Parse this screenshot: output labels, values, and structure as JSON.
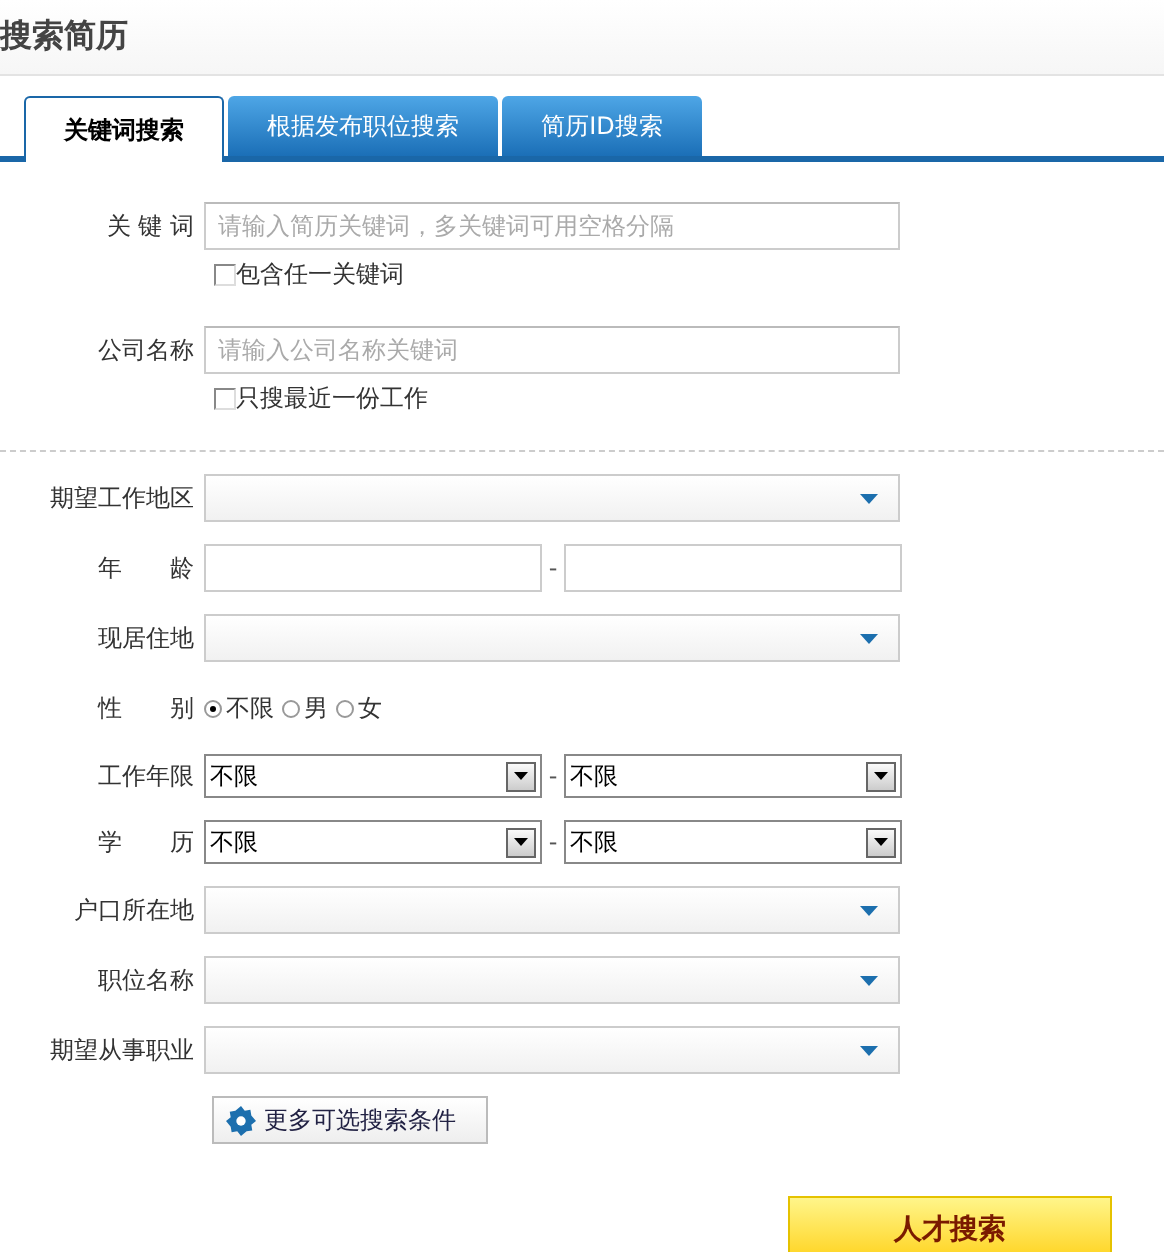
{
  "page_title": "搜索简历",
  "tabs": [
    {
      "label": "关键词搜索",
      "selected": true
    },
    {
      "label": "根据发布职位搜索",
      "selected": false
    },
    {
      "label": "简历ID搜索",
      "selected": false
    }
  ],
  "keyword_section": [
    {
      "label": "关 键 词",
      "placeholder": "请输入简历关键词，多关键词可用空格分隔",
      "option": {
        "label": "包含任一关键词",
        "checked": false
      }
    },
    {
      "label": "公司名称",
      "placeholder": "请输入公司名称关键词",
      "option": {
        "label": "只搜最近一份工作",
        "checked": false
      }
    }
  ],
  "filters": [
    {
      "kind": "dropdown",
      "label": "期望工作地区"
    },
    {
      "kind": "range",
      "label": "年　　龄",
      "separator": "-"
    },
    {
      "kind": "dropdown",
      "label": "现居住地"
    },
    {
      "kind": "radio",
      "label": "性　　别",
      "options": [
        {
          "label": "不限",
          "selected": true
        },
        {
          "label": "男",
          "selected": false
        },
        {
          "label": "女",
          "selected": false
        }
      ]
    },
    {
      "kind": "select_range",
      "label": "工作年限",
      "from": "不限",
      "to": "不限",
      "separator": "-"
    },
    {
      "kind": "select_range",
      "label": "学　　历",
      "from": "不限",
      "to": "不限",
      "separator": "-"
    },
    {
      "kind": "dropdown",
      "label": "户口所在地"
    },
    {
      "kind": "dropdown",
      "label": "职位名称"
    },
    {
      "kind": "dropdown",
      "label": "期望从事职业"
    }
  ],
  "more_button": "更多可选搜索条件",
  "search_button": "人才搜索"
}
